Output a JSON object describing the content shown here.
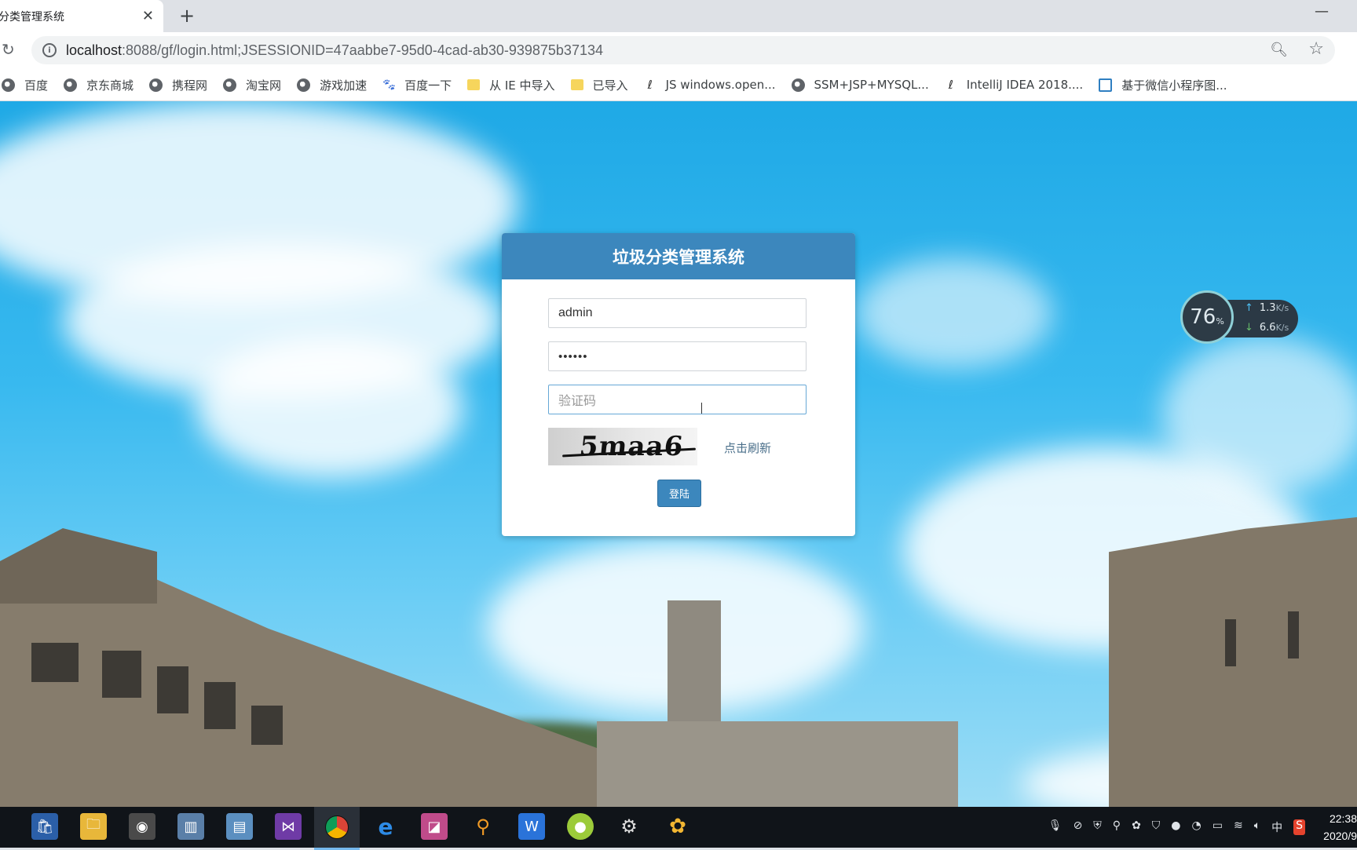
{
  "browser": {
    "tab_title": "分类管理系统",
    "url_host": "localhost",
    "url_rest": ":8088/gf/login.html;JSESSIONID=47aabbe7-95d0-4cad-ab30-939875b37134",
    "bookmarks": [
      {
        "label": "百度",
        "icon": "globe-icon"
      },
      {
        "label": "京东商城",
        "icon": "globe-icon"
      },
      {
        "label": "携程网",
        "icon": "globe-icon"
      },
      {
        "label": "淘宝网",
        "icon": "globe-icon"
      },
      {
        "label": "游戏加速",
        "icon": "globe-icon"
      },
      {
        "label": "百度一下",
        "icon": "paw-icon"
      },
      {
        "label": "从 IE 中导入",
        "icon": "folder-icon"
      },
      {
        "label": "已导入",
        "icon": "folder-icon"
      },
      {
        "label": "JS windows.open...",
        "icon": "idea-icon"
      },
      {
        "label": "SSM+JSP+MYSQL...",
        "icon": "globe-icon"
      },
      {
        "label": "IntelliJ IDEA 2018....",
        "icon": "idea-icon"
      },
      {
        "label": "基于微信小程序图...",
        "icon": "square-icon"
      }
    ]
  },
  "login": {
    "title": "垃圾分类管理系统",
    "username_value": "admin",
    "password_value": "••••••",
    "captcha_placeholder": "验证码",
    "captcha_text": "5maa6",
    "refresh_label": "点击刷新",
    "submit_label": "登陆",
    "accent_color": "#3c87bd"
  },
  "net_widget": {
    "percent": "76",
    "percent_unit": "%",
    "upload": "1.3",
    "download": "6.6",
    "unit": "K/s"
  },
  "taskbar": {
    "tray_ime": "中",
    "time": "22:38",
    "date": "2020/9"
  }
}
